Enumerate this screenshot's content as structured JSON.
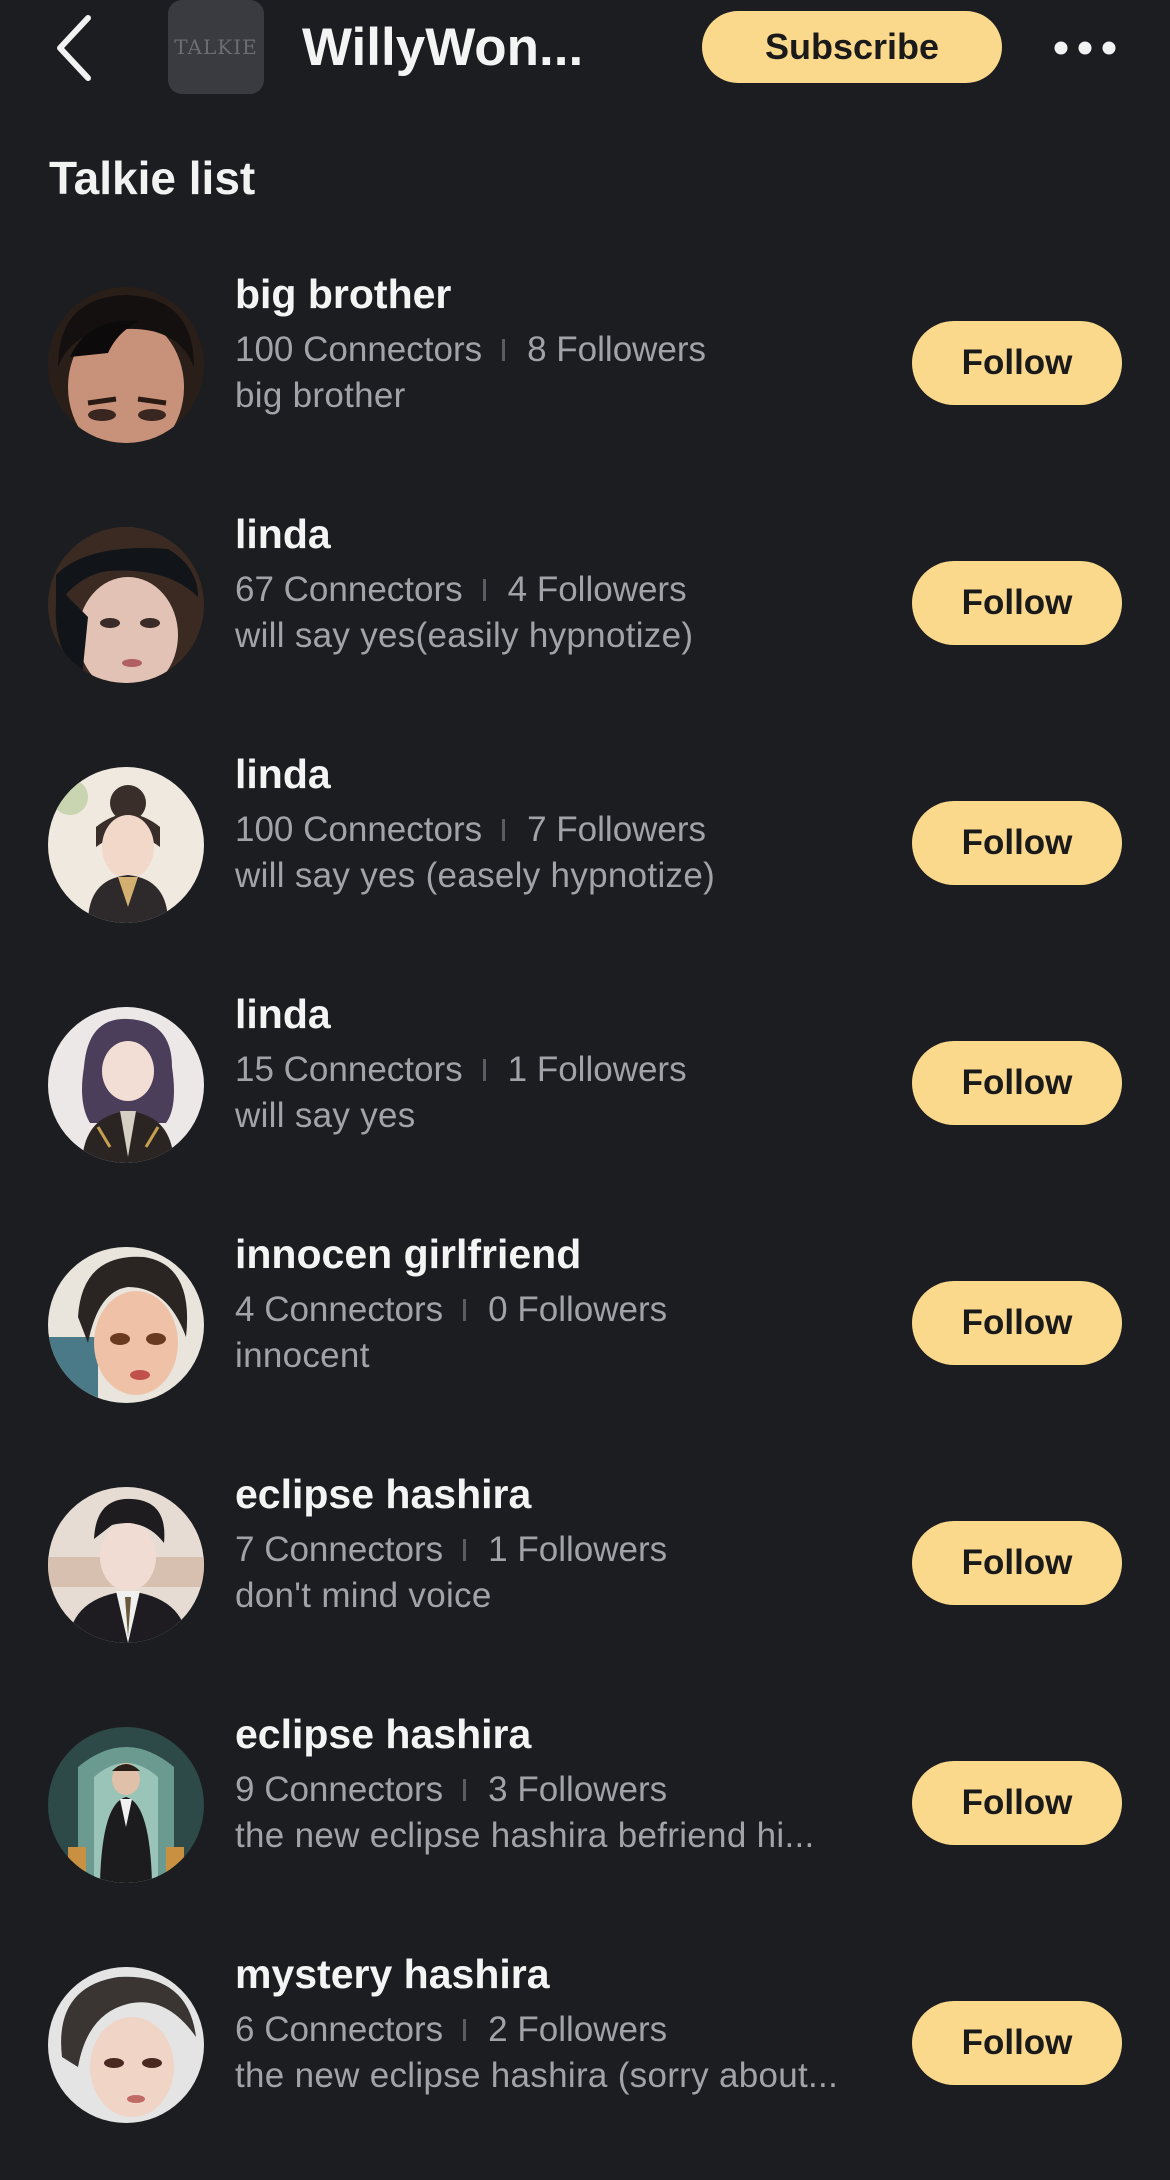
{
  "header": {
    "back_icon": "chevron-left-icon",
    "channel_logo_text": "TALKIE",
    "title": "WillyWon...",
    "subscribe_label": "Subscribe",
    "more_icon": "more-horizontal-icon"
  },
  "section": {
    "title": "Talkie list"
  },
  "colors": {
    "background": "#1c1d21",
    "accent": "#fad98c",
    "secondary_text": "#a2a3a8"
  },
  "talkies": [
    {
      "name": "big brother",
      "connectors": "100 Connectors",
      "followers": "8 Followers",
      "description": "big brother",
      "follow_label": "Follow"
    },
    {
      "name": "linda",
      "connectors": "67 Connectors",
      "followers": "4 Followers",
      "description": "will say yes(easily hypnotize)",
      "follow_label": "Follow"
    },
    {
      "name": "linda",
      "connectors": "100 Connectors",
      "followers": "7 Followers",
      "description": "will say yes (easely hypnotize)",
      "follow_label": "Follow"
    },
    {
      "name": "linda",
      "connectors": "15 Connectors",
      "followers": "1 Followers",
      "description": "will say yes",
      "follow_label": "Follow"
    },
    {
      "name": "innocen girlfriend",
      "connectors": "4 Connectors",
      "followers": "0 Followers",
      "description": "innocent",
      "follow_label": "Follow"
    },
    {
      "name": "eclipse hashira",
      "connectors": "7 Connectors",
      "followers": "1 Followers",
      "description": "don't mind voice",
      "follow_label": "Follow"
    },
    {
      "name": "eclipse hashira",
      "connectors": "9 Connectors",
      "followers": "3 Followers",
      "description": "the new eclipse hashira befriend hi...",
      "follow_label": "Follow"
    },
    {
      "name": "mystery hashira",
      "connectors": "6 Connectors",
      "followers": "2 Followers",
      "description": "the new eclipse hashira (sorry about...",
      "follow_label": "Follow"
    }
  ]
}
